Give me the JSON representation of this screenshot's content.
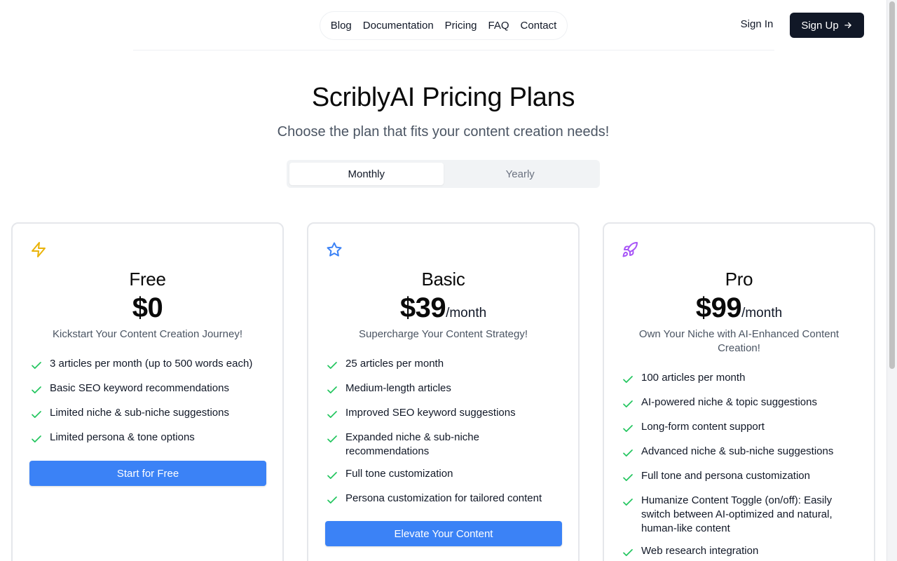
{
  "nav": {
    "links": [
      "Blog",
      "Documentation",
      "Pricing",
      "FAQ",
      "Contact"
    ],
    "sign_in": "Sign In",
    "sign_up": "Sign Up"
  },
  "hero": {
    "title": "ScriblyAI Pricing Plans",
    "subtitle": "Choose the plan that fits your content creation needs!"
  },
  "billing_toggle": {
    "monthly": "Monthly",
    "yearly": "Yearly",
    "selected": "Monthly"
  },
  "colors": {
    "accent": "#3b82f6",
    "dark": "#111827",
    "check": "#22c55e",
    "free_icon": "#eab308",
    "basic_icon": "#3b82f6",
    "pro_icon": "#a855f7"
  },
  "plans": [
    {
      "icon": "lightning-icon",
      "name": "Free",
      "price": "$0",
      "period": "",
      "tagline": "Kickstart Your Content Creation Journey!",
      "features": [
        "3 articles per month (up to 500 words each)",
        "Basic SEO keyword recommendations",
        "Limited niche & sub-niche suggestions",
        "Limited persona & tone options"
      ],
      "cta": "Start for Free"
    },
    {
      "icon": "star-icon",
      "name": "Basic",
      "price": "$39",
      "period": "/month",
      "tagline": "Supercharge Your Content Strategy!",
      "features": [
        "25 articles per month",
        "Medium-length articles",
        "Improved SEO keyword suggestions",
        "Expanded niche & sub-niche recommendations",
        "Full tone customization",
        "Persona customization for tailored content"
      ],
      "cta": "Elevate Your Content"
    },
    {
      "icon": "rocket-icon",
      "name": "Pro",
      "price": "$99",
      "period": "/month",
      "tagline": "Own Your Niche with AI-Enhanced Content Creation!",
      "features": [
        "100 articles per month",
        "AI-powered niche & topic suggestions",
        "Long-form content support",
        "Advanced niche & sub-niche suggestions",
        "Full tone and persona customization",
        "Humanize Content Toggle (on/off): Easily switch between AI-optimized and natural, human-like content",
        "Web research integration"
      ],
      "cta": ""
    }
  ]
}
